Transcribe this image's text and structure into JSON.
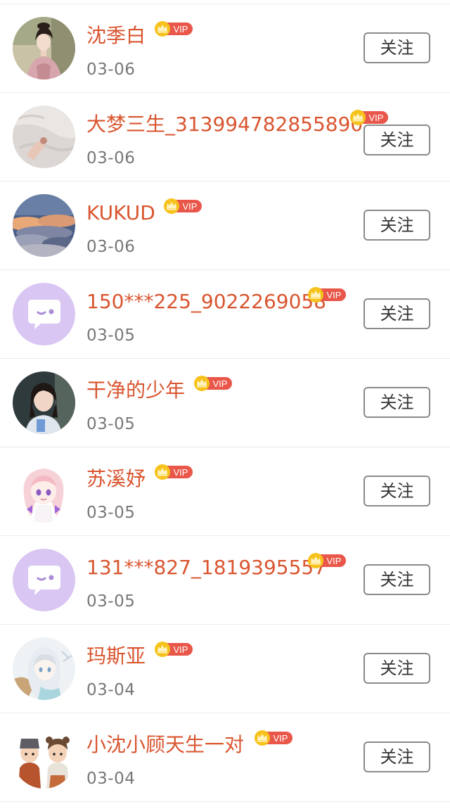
{
  "follow_list": {
    "follow_label": "关注",
    "vip_label": "VIP",
    "items": [
      {
        "name": "沈季白",
        "date": "03-06",
        "avatar": "photo-woman-pink-robe"
      },
      {
        "name": "大梦三生_313994782855890",
        "date": "03-06",
        "avatar": "photo-hand-on-white-cloth"
      },
      {
        "name": "KUKUD",
        "date": "03-06",
        "avatar": "photo-sky-clouds"
      },
      {
        "name": "150***225_9022269058",
        "date": "03-05",
        "avatar": "default-chat-bubble-icon"
      },
      {
        "name": "干净的少年",
        "date": "03-05",
        "avatar": "photo-girl-portrait"
      },
      {
        "name": "苏溪妤",
        "date": "03-05",
        "avatar": "anime-girl-pink-hair"
      },
      {
        "name": "131***827_1819395557",
        "date": "03-05",
        "avatar": "default-chat-bubble-icon"
      },
      {
        "name": "玛斯亚",
        "date": "03-04",
        "avatar": "anime-girl-white-hair"
      },
      {
        "name": "小沈小顾天生一对",
        "date": "03-04",
        "avatar": "cartoon-couple"
      }
    ]
  },
  "colors": {
    "name": "#d9552f",
    "vip_badge": "#e9574a",
    "crown": "#f5b800",
    "date": "#777777",
    "button_border": "#8a8a8a",
    "default_avatar_bg": "#d9c6f3"
  }
}
